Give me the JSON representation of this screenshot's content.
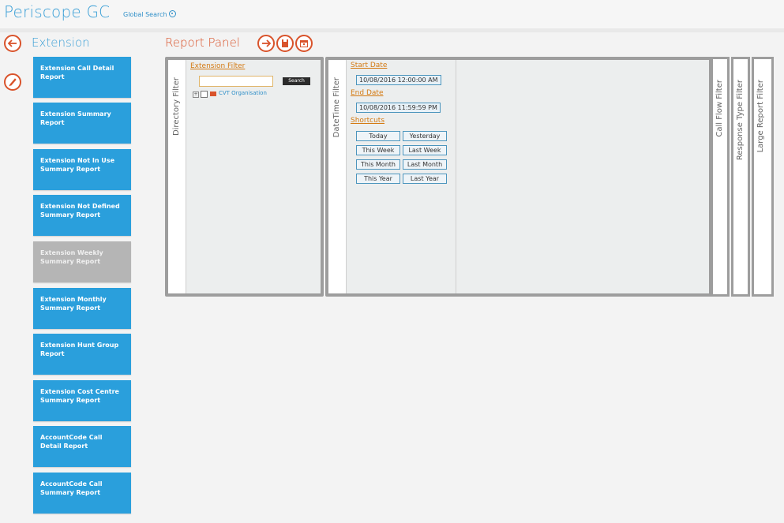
{
  "app": {
    "title": "Periscope GC",
    "global_search": "Global Search"
  },
  "sidebar": {
    "title": "Extension",
    "items": [
      {
        "label": "Extension Call Detail Report",
        "enabled": true
      },
      {
        "label": "Extension Summary Report",
        "enabled": true
      },
      {
        "label": "Extension Not In Use Summary Report",
        "enabled": true
      },
      {
        "label": "Extension Not Defined Summary Report",
        "enabled": true
      },
      {
        "label": "Extension Weekly Summary Report",
        "enabled": false
      },
      {
        "label": "Extension Monthly Summary Report",
        "enabled": true
      },
      {
        "label": "Extension Hunt Group Report",
        "enabled": true
      },
      {
        "label": "Extension Cost Centre Summary Report",
        "enabled": true
      },
      {
        "label": "AccountCode Call Detail Report",
        "enabled": true
      },
      {
        "label": "AccountCode Call Summary Report",
        "enabled": true
      }
    ]
  },
  "report_panel": {
    "title": "Report Panel",
    "tabs": {
      "directory": "Directory Filter",
      "datetime": "DateTime Filter",
      "call_flow": "Call Flow Filter",
      "response_type": "Response Type Filter",
      "large_report": "Large Report Filter"
    },
    "directory_filter": {
      "extension_filter_label": "Extension Filter",
      "search_input_value": "",
      "search_button": "Search",
      "tree_root": "CVT Organisation"
    },
    "datetime_filter": {
      "start_date_label": "Start Date",
      "start_date_value": "10/08/2016 12:00:00 AM",
      "end_date_label": "End Date",
      "end_date_value": "10/08/2016 11:59:59 PM",
      "shortcuts_label": "Shortcuts",
      "shortcuts": [
        "Today",
        "Yesterday",
        "This Week",
        "Last Week",
        "This Month",
        "Last Month",
        "This Year",
        "Last Year"
      ]
    }
  },
  "colors": {
    "brand_blue": "#3a9fd6",
    "tile_blue": "#2a9fdc",
    "accent_orange": "#d9532b",
    "filter_label_orange": "#d47a12",
    "disabled_gray": "#b5b5b5"
  }
}
